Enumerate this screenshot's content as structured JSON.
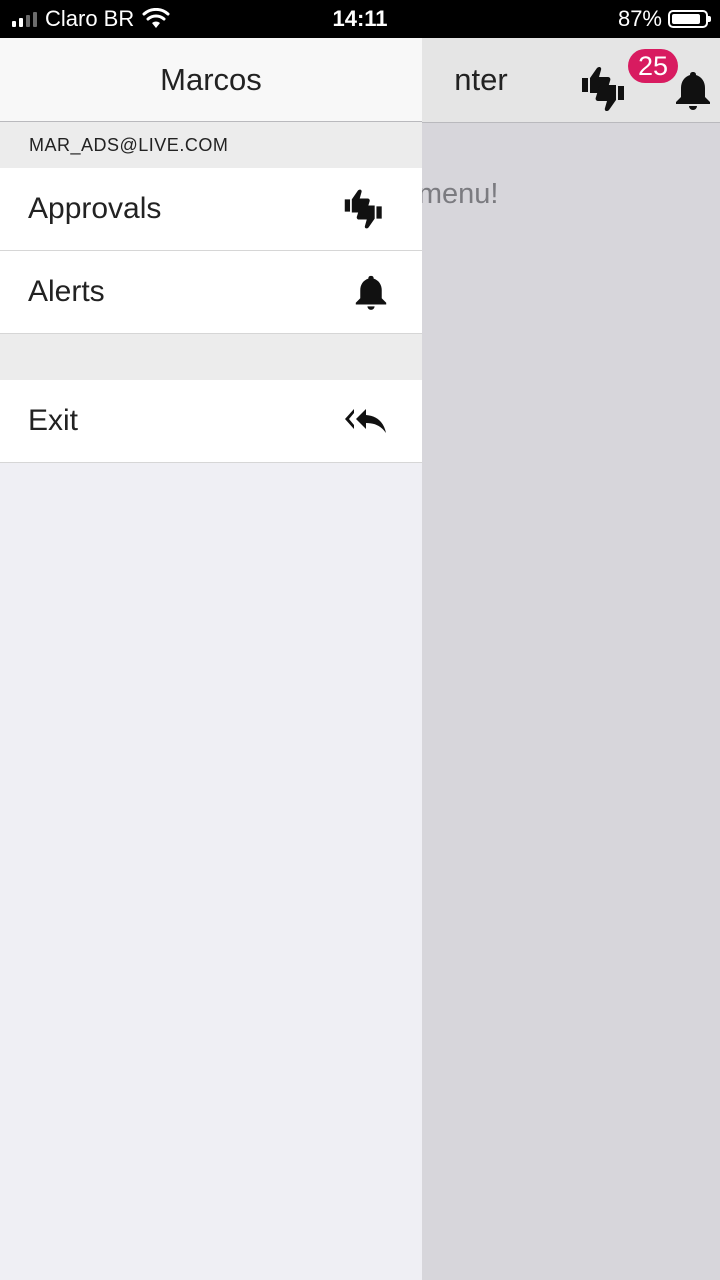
{
  "status_bar": {
    "carrier": "Claro BR",
    "time": "14:11",
    "battery": "87%"
  },
  "main": {
    "title": "nter",
    "message": "the menu!",
    "approvals_badge": "25",
    "header_icons": [
      "thumbs-up-down-icon",
      "bell-icon"
    ]
  },
  "drawer": {
    "title": "Marcos",
    "email": "MAR_ADS@LIVE.COM",
    "items": [
      {
        "label": "Approvals",
        "icon": "thumbs-up-down-icon"
      },
      {
        "label": "Alerts",
        "icon": "bell-icon"
      }
    ],
    "exit": {
      "label": "Exit",
      "icon": "reply-all-icon"
    }
  },
  "colors": {
    "badge": "#d81b60",
    "drawer_background": "#efeff4",
    "backdrop": "#d7d6db"
  }
}
